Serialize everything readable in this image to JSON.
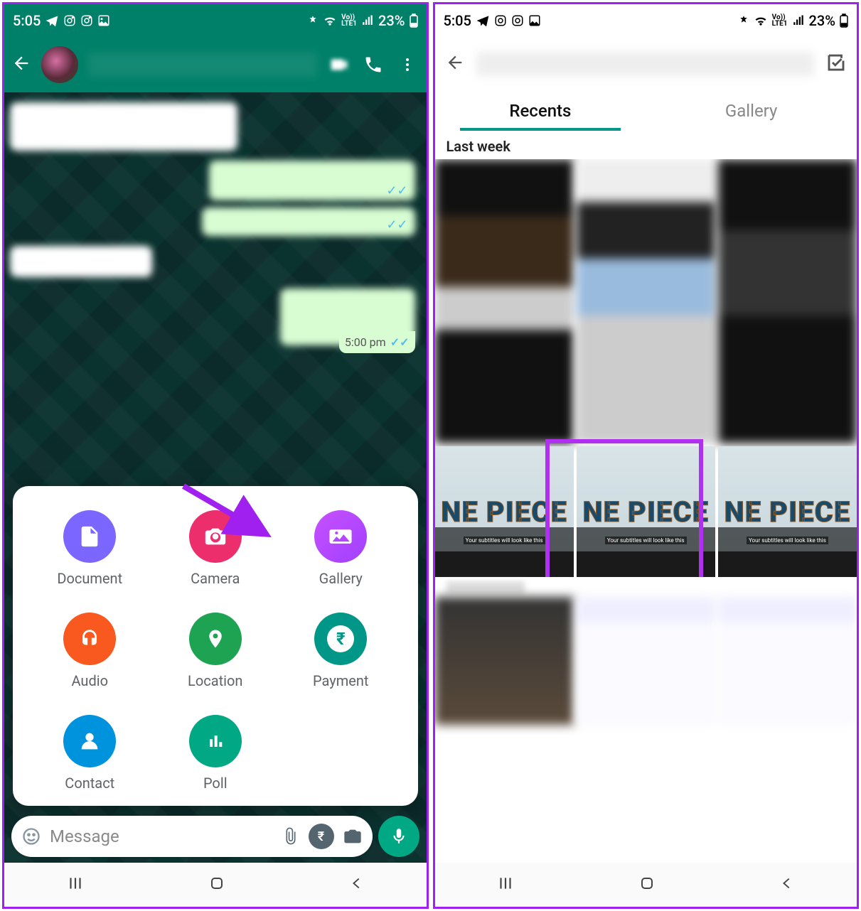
{
  "status_bar": {
    "time": "5:05",
    "battery": "23%",
    "vo_lte": "VoLTE1"
  },
  "left": {
    "chat": {
      "last_time": "5:00 pm"
    },
    "attach": {
      "document": "Document",
      "camera": "Camera",
      "gallery": "Gallery",
      "audio": "Audio",
      "location": "Location",
      "payment": "Payment",
      "contact": "Contact",
      "poll": "Poll"
    },
    "input": {
      "placeholder": "Message"
    }
  },
  "right": {
    "tabs": {
      "recents": "Recents",
      "gallery": "Gallery"
    },
    "section": "Last week",
    "one_piece_label": "NE PIECE",
    "subtitle_hint": "Your subtitles will look like this"
  }
}
